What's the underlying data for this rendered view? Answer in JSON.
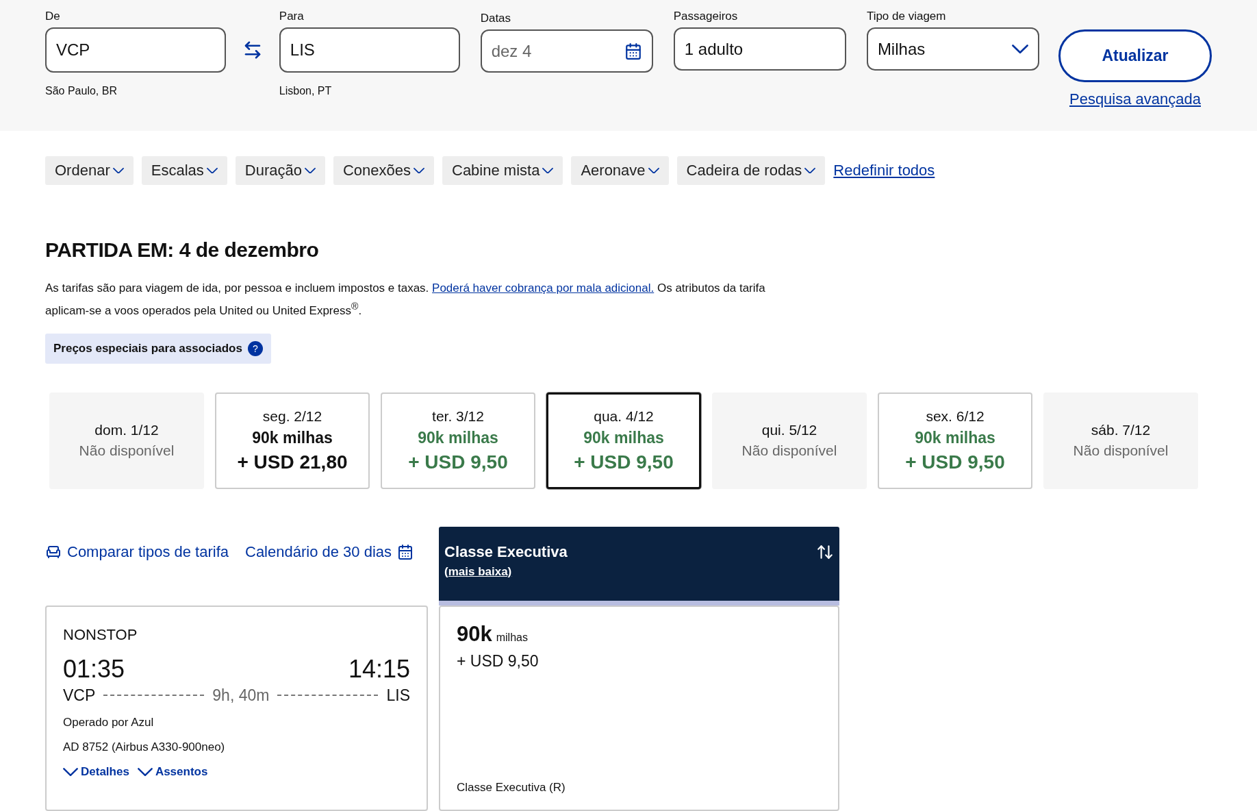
{
  "search": {
    "from": {
      "label": "De",
      "value": "VCP",
      "city": "São Paulo, BR"
    },
    "to": {
      "label": "Para",
      "value": "LIS",
      "city": "Lisbon, PT"
    },
    "dates": {
      "label": "Datas",
      "placeholder": "dez 4"
    },
    "passengers": {
      "label": "Passageiros",
      "value": "1 adulto"
    },
    "trip_type": {
      "label": "Tipo de viagem",
      "value": "Milhas"
    },
    "submit": "Atualizar",
    "advanced_link": "Pesquisa avançada"
  },
  "filters": [
    "Ordenar",
    "Escalas",
    "Duração",
    "Conexões",
    "Cabine mista",
    "Aeronave",
    "Cadeira de rodas"
  ],
  "reset_link": "Redefinir todos",
  "heading": "PARTIDA EM: 4 de dezembro",
  "note": {
    "before": "As tarifas são para viagem de ida, por pessoa e incluem impostos e taxas.",
    "link": "Poderá haver cobrança por mala adicional.",
    "after": "Os atributos da tarifa aplicam-se a voos operados pela United ou United Express$^{®}$."
  },
  "member_badge": {
    "text": "Preços especiais para associados",
    "help": "?"
  },
  "dates": [
    {
      "kind": "unavailable",
      "day": "dom. 1/12",
      "status": "Não disponível",
      "selected": false
    },
    {
      "kind": "price",
      "day": "seg. 2/12",
      "miles": "90k milhas",
      "cash": "+ USD 21,80",
      "lowest": false,
      "selected": false
    },
    {
      "kind": "price",
      "day": "ter. 3/12",
      "miles": "90k milhas",
      "cash": "+ USD 9,50",
      "lowest": true,
      "selected": false
    },
    {
      "kind": "price",
      "day": "qua. 4/12",
      "miles": "90k milhas",
      "cash": "+ USD 9,50",
      "lowest": true,
      "selected": true
    },
    {
      "kind": "unavailable",
      "day": "qui. 5/12",
      "status": "Não disponível",
      "selected": false
    },
    {
      "kind": "price",
      "day": "sex. 6/12",
      "miles": "90k milhas",
      "cash": "+ USD 9,50",
      "lowest": true,
      "selected": false
    },
    {
      "kind": "unavailable",
      "day": "sáb. 7/12",
      "status": "Não disponível",
      "selected": false
    }
  ],
  "links": {
    "compare": "Comparar tipos de tarifa",
    "calendar": "Calendário de 30 dias"
  },
  "cabin_header": {
    "title": "Classe Executiva",
    "subtitle": "(mais baixa)"
  },
  "flight": {
    "stops": "NONSTOP",
    "depart_time": "01:35",
    "arrive_time": "14:15",
    "origin": "VCP",
    "destination": "LIS",
    "duration": "9h, 40m",
    "operator": "Operado por Azul",
    "flight_number": "AD 8752 (Airbus A330-900neo)",
    "details": "Detalhes",
    "seats": "Assentos"
  },
  "fare": {
    "miles": "90k",
    "miles_unit": "milhas",
    "cash": "+ USD 9,50",
    "fare_class": "Classe Executiva (R)"
  }
}
